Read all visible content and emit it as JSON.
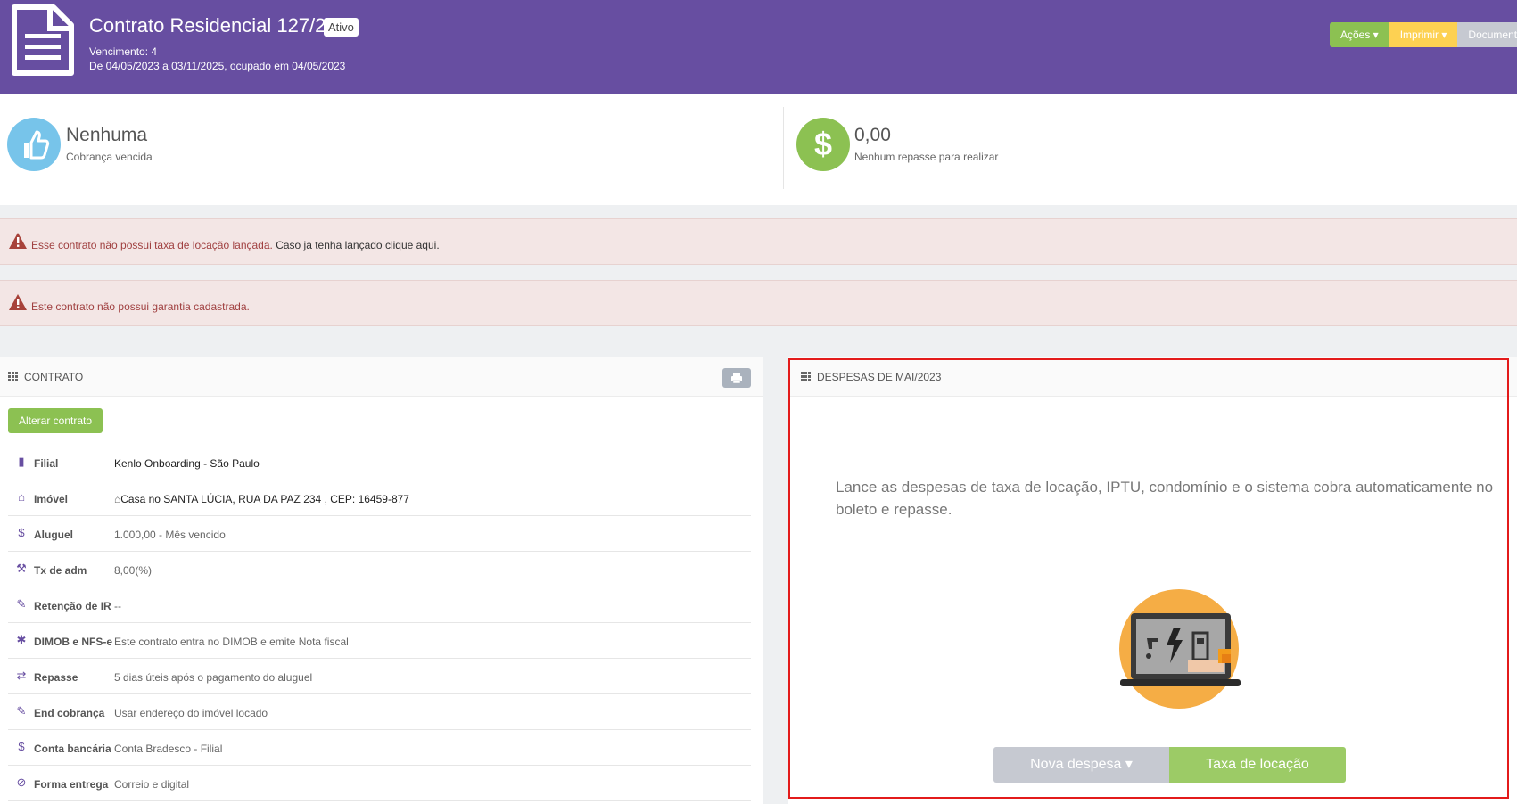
{
  "header": {
    "title": "Contrato Residencial 127/2",
    "status_badge": "Ativo",
    "vencimento": "Vencimento: 4",
    "periodo": "De 04/05/2023 a 03/11/2025, ocupado em 04/05/2023",
    "actions": {
      "acoes": "Ações ▾",
      "imprimir": "Imprimir ▾",
      "documentos": "Documentos"
    },
    "color": "#674ea1"
  },
  "summary": {
    "cobranca": {
      "value": "Nenhuma",
      "label": "Cobrança vencida",
      "icon": "thumbs-up-icon"
    },
    "repasse": {
      "value": "0,00",
      "label": "Nenhum repasse para realizar",
      "icon": "dollar-icon"
    }
  },
  "alerts": [
    {
      "text": "Esse contrato não possui taxa de locação lançada.",
      "link": "Caso ja tenha lançado clique aqui."
    },
    {
      "text": "Este contrato não possui garantia cadastrada."
    }
  ],
  "contrato": {
    "title": "CONTRATO",
    "alter_button": "Alterar contrato",
    "rows": [
      {
        "icon": "building-icon",
        "label": "Filial",
        "value": "Kenlo Onboarding - São Paulo"
      },
      {
        "icon": "home-icon",
        "label": "Imóvel",
        "value": "Casa no SANTA LÚCIA, RUA DA PAZ 234 , CEP: 16459-877"
      },
      {
        "icon": "dollar-icon",
        "label": "Aluguel",
        "value": "1.000,00 - Mês vencido"
      },
      {
        "icon": "gavel-icon",
        "label": "Tx de adm",
        "value": "8,00(%)"
      },
      {
        "icon": "pin-icon",
        "label": "Retenção de IR",
        "value": "--"
      },
      {
        "icon": "asterisk-icon",
        "label": "DIMOB e NFS-e",
        "value": "Este contrato entra no DIMOB e emite Nota fiscal"
      },
      {
        "icon": "transfer-icon",
        "label": "Repasse",
        "value": "5 dias úteis após o pagamento do aluguel"
      },
      {
        "icon": "pin-icon",
        "label": "End cobrança",
        "value": "Usar endereço do imóvel locado"
      },
      {
        "icon": "dollar-icon",
        "label": "Conta bancária",
        "value": "Conta Bradesco - Filial"
      },
      {
        "icon": "paperclip-icon",
        "label": "Forma entrega",
        "value": "Correio e digital"
      }
    ]
  },
  "despesas": {
    "title": "DESPESAS DE MAI/2023",
    "intro": "Lance as despesas de taxa de locação, IPTU, condomínio e o sistema cobra automaticamente no boleto e repasse.",
    "nova_despesa": "Nova despesa ▾",
    "taxa_locacao": "Taxa de locação",
    "illustration": "laptop-bills-illustration"
  }
}
